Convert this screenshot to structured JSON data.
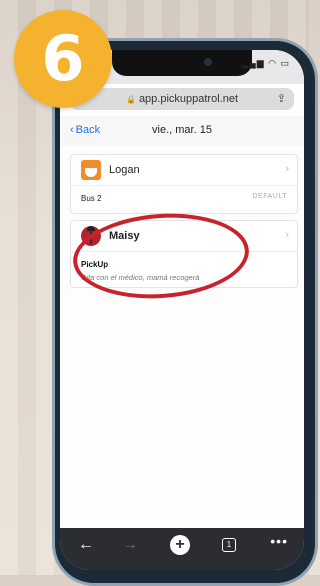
{
  "badge": {
    "number": "6"
  },
  "browser": {
    "url": "app.pickuppatrol.net"
  },
  "nav": {
    "back_label": "Back",
    "date": "vie., mar. 15"
  },
  "students": [
    {
      "name": "Logan",
      "avatar_icon": "fox-icon",
      "method": "Bus 2",
      "tag": "DEFAULT"
    },
    {
      "name": "Maisy",
      "avatar_icon": "ladybug-icon",
      "method": "PickUp",
      "note": "Cita con el médico, mamá recogerá"
    }
  ],
  "colors": {
    "badge": "#f4b22f",
    "highlight_ring": "#c8232d",
    "link": "#1a73e8",
    "toolbar": "#2b2d33"
  },
  "toolbar": {
    "tab_count": "1"
  }
}
